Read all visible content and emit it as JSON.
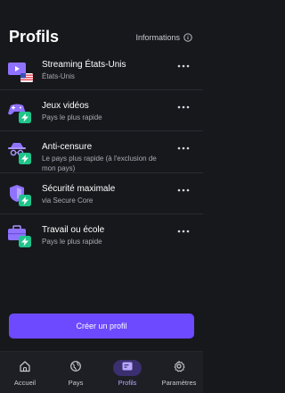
{
  "header": {
    "title": "Profils",
    "info_label": "Informations"
  },
  "profiles": [
    {
      "name": "Streaming États-Unis",
      "subtitle": "États-Unis",
      "icon": "streaming-us-icon"
    },
    {
      "name": "Jeux vidéos",
      "subtitle": "Pays le plus rapide",
      "icon": "gamepad-icon"
    },
    {
      "name": "Anti-censure",
      "subtitle": "Le pays plus rapide (à l'exclusion de mon pays)",
      "icon": "spy-icon"
    },
    {
      "name": "Sécurité maximale",
      "subtitle": "via Secure Core",
      "icon": "shield-icon"
    },
    {
      "name": "Travail ou école",
      "subtitle": "Pays le plus rapide",
      "icon": "briefcase-icon"
    }
  ],
  "create_button_label": "Créer un profil",
  "tabs": [
    {
      "label": "Accueil",
      "icon": "home-icon",
      "active": false
    },
    {
      "label": "Pays",
      "icon": "globe-icon",
      "active": false
    },
    {
      "label": "Profils",
      "icon": "profiles-icon",
      "active": true
    },
    {
      "label": "Paramètres",
      "icon": "gear-icon",
      "active": false
    }
  ],
  "colors": {
    "background": "#17181c",
    "accent": "#6d4aff",
    "accent_light": "#b9a8ff",
    "badge_green": "#1fc48a",
    "tab_active_bg": "#3b2f70"
  }
}
